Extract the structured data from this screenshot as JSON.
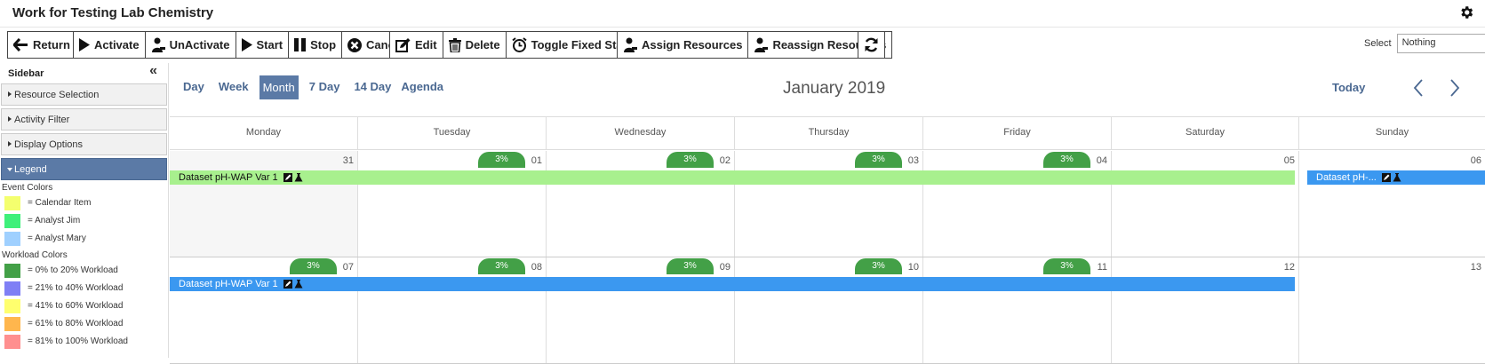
{
  "app": {
    "title": "Work for Testing Lab Chemistry"
  },
  "toolbar": {
    "return": "Return",
    "activate": "Activate",
    "unactivate": "UnActivate",
    "start": "Start",
    "stop": "Stop",
    "cancel": "Cancel",
    "edit": "Edit",
    "delete": "Delete",
    "toggle_fixed_start": "Toggle Fixed Start",
    "assign_resources": "Assign Resources",
    "reassign_resources": "Reassign Resources",
    "select_label": "Select",
    "select_value": "Nothing"
  },
  "sidebar": {
    "title": "Sidebar",
    "panels": {
      "resource_selection": "Resource Selection",
      "activity_filter": "Activity Filter",
      "display_options": "Display Options",
      "legend": "Legend"
    },
    "event_colors_title": "Event Colors",
    "event_colors": [
      {
        "label": "= Calendar Item",
        "color": "#f4ff6e"
      },
      {
        "label": "= Analyst Jim",
        "color": "#3ff07a"
      },
      {
        "label": "= Analyst Mary",
        "color": "#9fd0ff"
      }
    ],
    "workload_colors_title": "Workload Colors",
    "workload_colors": [
      {
        "label": "= 0% to 20% Workload",
        "color": "#43a047"
      },
      {
        "label": "= 21% to 40% Workload",
        "color": "#7f7ff5"
      },
      {
        "label": "= 41% to 60% Workload",
        "color": "#ffff6e"
      },
      {
        "label": "= 61% to 80% Workload",
        "color": "#ffb64d"
      },
      {
        "label": "= 81% to 100% Workload",
        "color": "#ff8f8f"
      }
    ]
  },
  "calendar": {
    "views": {
      "day": "Day",
      "week": "Week",
      "month": "Month",
      "seven_day": "7 Day",
      "fourteen_day": "14 Day",
      "agenda": "Agenda"
    },
    "active_view": "Month",
    "title": "January 2019",
    "today": "Today",
    "weekdays": [
      "Monday",
      "Tuesday",
      "Wednesday",
      "Thursday",
      "Friday",
      "Saturday",
      "Sunday"
    ],
    "weeks": [
      {
        "days": [
          "31",
          "01",
          "02",
          "03",
          "04",
          "05",
          "06"
        ],
        "badges": [
          "",
          "3%",
          "3%",
          "3%",
          "3%",
          "",
          ""
        ],
        "events": [
          {
            "label": "Dataset pH-WAP Var 1",
            "color": "green"
          },
          {
            "label": "Dataset pH-...",
            "color": "blue"
          }
        ]
      },
      {
        "days": [
          "07",
          "08",
          "09",
          "10",
          "11",
          "12",
          "13"
        ],
        "badges": [
          "3%",
          "3%",
          "3%",
          "3%",
          "3%",
          "",
          ""
        ],
        "events": [
          {
            "label": "Dataset pH-WAP Var 1",
            "color": "blue"
          }
        ]
      }
    ]
  }
}
